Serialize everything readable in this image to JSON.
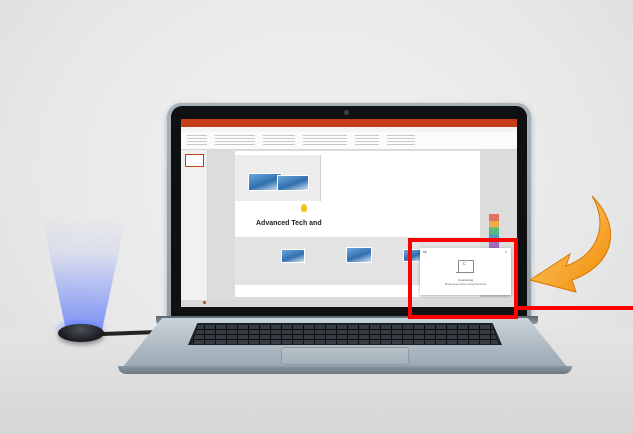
{
  "scene": {
    "accent_red": "#ff0000",
    "projector_beam_color": "#5a78ff",
    "arrow_color": "#f39c12"
  },
  "presentation": {
    "slide_title": "Advanced Tech and",
    "slide_title_icon": "lightbulb-icon",
    "brand_color": "#c43e1c"
  },
  "connection_dialog": {
    "title": "Mir",
    "close_icon": "close-icon",
    "device_icon": "laptop-icon",
    "status": "Connecting",
    "note": "Please keep device being Connected"
  }
}
